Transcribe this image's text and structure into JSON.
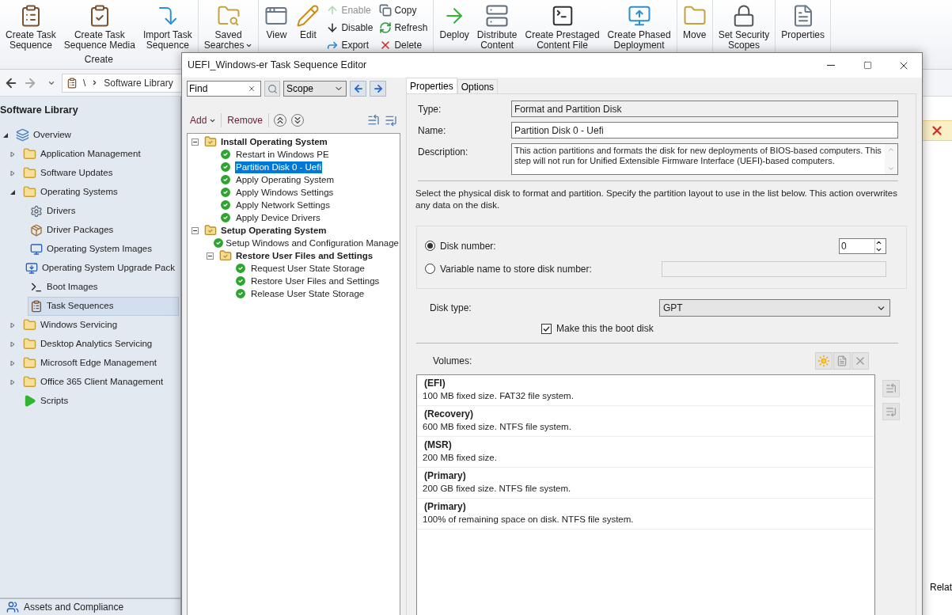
{
  "ribbon": {
    "groups": [
      {
        "label": "Create",
        "items": [
          {
            "kind": "large",
            "label": "Create Task\nSequence"
          },
          {
            "kind": "large",
            "label": "Create Task\nSequence Media"
          },
          {
            "kind": "large",
            "label": "Import Task\nSequence"
          }
        ]
      },
      {
        "items": [
          {
            "kind": "large",
            "label": "Saved\nSearches",
            "menu": true
          }
        ]
      },
      {
        "items": [
          {
            "kind": "large",
            "label": "View"
          },
          {
            "kind": "large",
            "label": "Edit"
          },
          {
            "kind": "stack",
            "items": [
              {
                "label": "Enable",
                "disabled": true
              },
              {
                "label": "Disable",
                "disabled": false
              },
              {
                "label": "Export",
                "disabled": false
              }
            ]
          },
          {
            "kind": "stack",
            "items": [
              {
                "label": "Copy",
                "disabled": false
              },
              {
                "label": "Refresh",
                "disabled": false
              },
              {
                "label": "Delete",
                "disabled": false
              }
            ]
          }
        ]
      },
      {
        "items": [
          {
            "kind": "large",
            "label": "Deploy"
          },
          {
            "kind": "large",
            "label": "Distribute\nContent"
          },
          {
            "kind": "large",
            "label": "Create Prestaged\nContent File"
          },
          {
            "kind": "large",
            "label": "Create Phased\nDeployment"
          }
        ]
      },
      {
        "items": [
          {
            "kind": "large",
            "label": "Move"
          }
        ]
      },
      {
        "items": [
          {
            "kind": "large",
            "label": "Set Security\nScopes"
          }
        ]
      },
      {
        "items": [
          {
            "kind": "large",
            "label": "Properties"
          }
        ]
      }
    ]
  },
  "address_bar": {
    "path": [
      "\\",
      "Software Library"
    ]
  },
  "navigation": {
    "title": "Software Library",
    "items": [
      {
        "label": "Overview",
        "kind": "overview",
        "expanded": true,
        "selected": false,
        "children": [
          {
            "label": "Application Management",
            "kind": "folder",
            "expanded": false,
            "selected": false
          },
          {
            "label": "Software Updates",
            "kind": "folder",
            "expanded": false,
            "selected": false
          },
          {
            "label": "Operating Systems",
            "kind": "folder",
            "expanded": true,
            "selected": false,
            "children": [
              {
                "label": "Drivers",
                "kind": "leaf",
                "selected": false
              },
              {
                "label": "Driver Packages",
                "kind": "leaf",
                "selected": false
              },
              {
                "label": "Operating System Images",
                "kind": "leaf",
                "selected": false
              },
              {
                "label": "Operating System Upgrade Pack",
                "kind": "leaf",
                "selected": false
              },
              {
                "label": "Boot Images",
                "kind": "leaf",
                "selected": false
              },
              {
                "label": "Task Sequences",
                "kind": "leaf",
                "selected": true
              }
            ]
          },
          {
            "label": "Windows Servicing",
            "kind": "folder",
            "expanded": false,
            "selected": false
          },
          {
            "label": "Desktop Analytics Servicing",
            "kind": "folder",
            "expanded": false,
            "selected": false
          },
          {
            "label": "Microsoft Edge Management",
            "kind": "folder",
            "expanded": false,
            "selected": false
          },
          {
            "label": "Office 365 Client Management",
            "kind": "folder",
            "expanded": false,
            "selected": false
          },
          {
            "label": "Scripts",
            "kind": "script",
            "selected": false
          }
        ]
      }
    ],
    "bottom_section": "Assets and Compliance"
  },
  "background_pane": {
    "label": "Relat"
  },
  "editor": {
    "title": "UEFI_Windows-er Task Sequence Editor",
    "find": {
      "value": "Find"
    },
    "scope": {
      "value": "Scope"
    },
    "toolbar": {
      "add": "Add",
      "remove": "Remove"
    },
    "tree": [
      {
        "label": "Install Operating System",
        "kind": "group",
        "expanded": true,
        "selected": false,
        "children": [
          {
            "label": "Restart in Windows PE",
            "kind": "step",
            "selected": false
          },
          {
            "label": "Partition Disk 0 - Uefi",
            "kind": "step",
            "selected": true
          },
          {
            "label": "Apply Operating System",
            "kind": "step",
            "selected": false
          },
          {
            "label": "Apply Windows Settings",
            "kind": "step",
            "selected": false
          },
          {
            "label": "Apply Network Settings",
            "kind": "step",
            "selected": false
          },
          {
            "label": "Apply Device Drivers",
            "kind": "step",
            "selected": false
          }
        ]
      },
      {
        "label": "Setup Operating System",
        "kind": "group",
        "expanded": true,
        "selected": false,
        "children": [
          {
            "label": "Setup Windows and Configuration Manage",
            "kind": "step",
            "selected": false
          },
          {
            "label": "Restore User Files and Settings",
            "kind": "group",
            "expanded": true,
            "selected": false,
            "children": [
              {
                "label": "Request User State Storage",
                "kind": "step",
                "selected": false
              },
              {
                "label": "Restore User Files and Settings",
                "kind": "step",
                "selected": false
              },
              {
                "label": "Release User State Storage",
                "kind": "step",
                "selected": false
              }
            ]
          }
        ]
      }
    ],
    "tabs": [
      {
        "label": "Properties",
        "selected": true
      },
      {
        "label": "Options",
        "selected": false
      }
    ],
    "form": {
      "type_label": "Type:",
      "type_value": "Format and Partition Disk",
      "name_label": "Name:",
      "name_value": "Partition Disk 0 - Uefi",
      "description_label": "Description:",
      "description_value": "This action partitions and formats the disk for new deployments of BIOS-based computers. This step will not run for Unified Extensible Firmware Interface (UEFI)-based computers.",
      "instructions": "Select the physical disk to format and partition. Specify the partition layout to use in the list below. This action overwrites any data on the disk.",
      "disk_number": {
        "label": "Disk number:",
        "selected": true,
        "value": "0"
      },
      "variable": {
        "label": "Variable name to store disk number:",
        "selected": false
      },
      "disk_type": {
        "label": "Disk type:",
        "value": "GPT"
      },
      "boot_disk": {
        "label": "Make this the boot disk",
        "checked": true
      },
      "volumes_label": "Volumes:",
      "volumes": [
        {
          "title": "(EFI)",
          "description": "100 MB fixed size. FAT32 file system."
        },
        {
          "title": "(Recovery)",
          "description": "600 MB fixed size. NTFS file system."
        },
        {
          "title": "(MSR)",
          "description": "200 MB fixed size."
        },
        {
          "title": "(Primary)",
          "description": "200 GB fixed size. NTFS file system."
        },
        {
          "title": "(Primary)",
          "description": "100% of remaining space on disk. NTFS file system."
        }
      ]
    }
  }
}
